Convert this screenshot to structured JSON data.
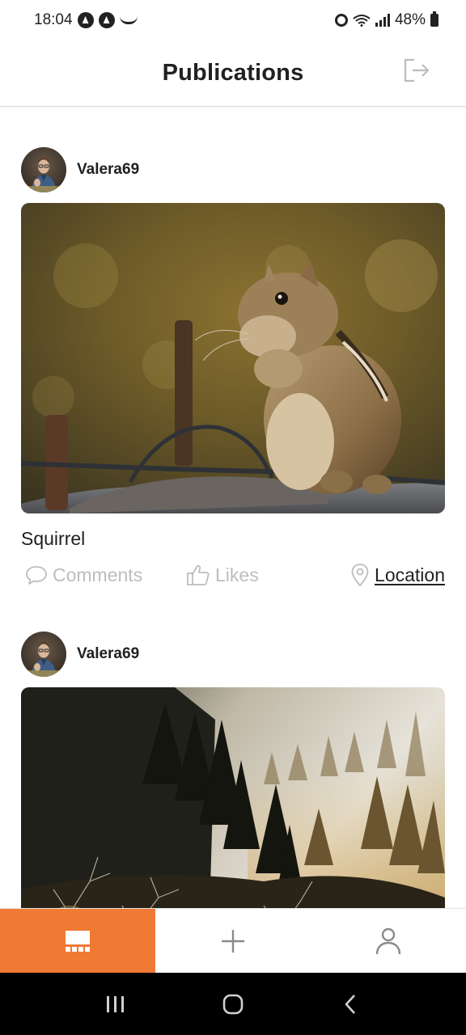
{
  "status_bar": {
    "time": "18:04",
    "battery": "48%"
  },
  "header": {
    "title": "Publications",
    "logout_icon": "logout-icon"
  },
  "posts": [
    {
      "author": "Valera69",
      "title": "Squirrel",
      "comments_label": "Comments",
      "likes_label": "Likes",
      "location_label": "Location"
    },
    {
      "author": "Valera69"
    }
  ],
  "bottom_nav": {
    "items": [
      {
        "icon": "posts-grid-icon",
        "active": true
      },
      {
        "icon": "plus-icon",
        "active": false
      },
      {
        "icon": "user-icon",
        "active": false
      }
    ],
    "accent": "#f07a34"
  },
  "colors": {
    "accent": "#f07a34",
    "muted": "#bdbdbd",
    "text": "#212121"
  }
}
